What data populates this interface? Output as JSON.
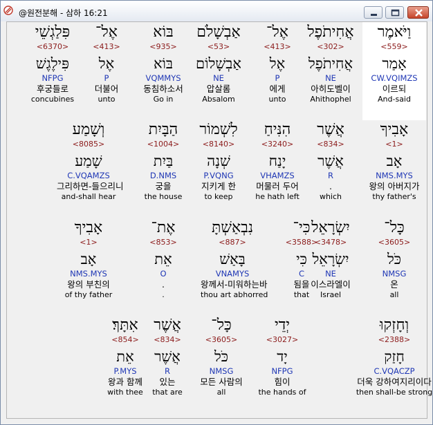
{
  "window": {
    "title": "@원전분해 - 삼하 16:21",
    "minimize_icon": "minimize-icon",
    "maximize_icon": "maximize-icon",
    "close_icon": "close-icon"
  },
  "colors": {
    "strong": "#8b1a1a",
    "morph": "#1f37b5",
    "highlight": "#ffffff",
    "background": "#f0f0f0"
  },
  "rows": [
    [
      {
        "heb": "וַיֹּאמֶר",
        "strong": "<559>",
        "lemma": "אָמַר",
        "morph": "CW.VQIMZS",
        "kor": "이르되",
        "eng": "And-said"
      },
      {
        "heb": "אֲחִיתֹפֶל",
        "strong": "<302>",
        "lemma": "אֲחִיתֹפֶל",
        "morph": "NE",
        "kor": "아히도벨이",
        "eng": "Ahithophel"
      },
      {
        "heb": "אֶל־",
        "strong": "<413>",
        "lemma": "אֶל",
        "morph": "P",
        "kor": "에게",
        "eng": "unto"
      },
      {
        "heb": "אַבְשָׁלֹם",
        "strong": "<53>",
        "lemma": "אַבְשָׁלוֹם",
        "morph": "NE",
        "kor": "압살롬",
        "eng": "Absalom"
      },
      {
        "heb": "בּוֹא",
        "strong": "<935>",
        "lemma": "בּוֹא",
        "morph": "VQMMYS",
        "kor": "동침하소서",
        "eng": "Go in"
      },
      {
        "heb": "אֶל־",
        "strong": "<413>",
        "lemma": "אֶל",
        "morph": "P",
        "kor": "더불어",
        "eng": "unto"
      },
      {
        "heb": "פִּלַגְשֵׁי",
        "strong": "<6370>",
        "lemma": "פִּילֶגֶשׁ",
        "morph": "NFPG",
        "kor": "후궁들로",
        "eng": "concubines"
      }
    ],
    [
      {
        "heb": "אָבִיךָ",
        "strong": "<1>",
        "lemma": "אָב",
        "morph": "NMS.MYS",
        "kor": "왕의 아버지가",
        "eng": "thy father's"
      },
      {
        "heb": "אֲשֶׁר",
        "strong": "<834>",
        "lemma": "אֲשֶׁר",
        "morph": "R",
        "kor": ".",
        "eng": "which"
      },
      {
        "heb": "הִנִּיחַ",
        "strong": "<3240>",
        "lemma": "יָנַח",
        "morph": "VHAMZS",
        "kor": "머물러 두어",
        "eng": "he hath left"
      },
      {
        "heb": "לִשְׁמוֹר",
        "strong": "<8140>",
        "lemma": "שְׁנָה",
        "morph": "P.VQNG",
        "kor": "지키게 한",
        "eng": "to keep"
      },
      {
        "heb": "הַבָּיִת",
        "strong": "<1004>",
        "lemma": "בַּיִת",
        "morph": "D.NMS",
        "kor": "궁을",
        "eng": "the house"
      },
      {
        "heb": "וְשָׁמַע",
        "strong": "<8085>",
        "lemma": "שָׁמַע",
        "morph": "C.VQAMZS",
        "kor": "그리하면-들으리니",
        "eng": "and-shall hear"
      }
    ],
    [
      {
        "heb": "כָּל־",
        "strong": "<3605>",
        "lemma": "כֹּל",
        "morph": "NMSG",
        "kor": "온",
        "eng": "all"
      },
      {
        "heb": "יִשְׂרָאֵל",
        "strong": "<3478>",
        "lemma": "יִשְׂרָאֵל",
        "morph": "NE",
        "kor": "이스라엘이",
        "eng": "Israel"
      },
      {
        "heb": "כִּי־",
        "strong": "<3588>",
        "lemma": "כִּי",
        "morph": "C",
        "kor": "됨을",
        "eng": "that"
      },
      {
        "heb": "נִבְאַשְׁתָּ",
        "strong": "<887>",
        "lemma": "בָּאַשׁ",
        "morph": "VNAMYS",
        "kor": "왕께서-미워하는바",
        "eng": "thou art abhorred"
      },
      {
        "heb": "אֶת־",
        "strong": "<853>",
        "lemma": "אֵת",
        "morph": "O",
        "kor": ".",
        "eng": "."
      },
      {
        "heb": "אָבִיךָ",
        "strong": "<1>",
        "lemma": "אָב",
        "morph": "NMS.MYS",
        "kor": "왕의 부친의",
        "eng": "of thy father"
      }
    ],
    [
      {
        "heb": "וְחָזְקוּ",
        "strong": "<2388>",
        "lemma": "חָזַק",
        "morph": "C.VQACZP",
        "kor": "더욱 강하여지리이다",
        "eng": "then shall-be strong"
      },
      {
        "heb": "יְדֵי",
        "strong": "<3027>",
        "lemma": "יָד",
        "morph": "NFPG",
        "kor": "힘이",
        "eng": "the hands of"
      },
      {
        "heb": "כָּל־",
        "strong": "<3605>",
        "lemma": "כֹּל",
        "morph": "NMSG",
        "kor": "모든 사람의",
        "eng": "all"
      },
      {
        "heb": "אֲשֶׁר",
        "strong": "<834>",
        "lemma": "אֲשֶׁר",
        "morph": "R",
        "kor": "있는",
        "eng": "that are"
      },
      {
        "heb": "אִתָּךְ׃",
        "strong": "<854>",
        "lemma": "אֵת",
        "morph": "P.MYS",
        "kor": "왕과 함께",
        "eng": "with thee"
      }
    ]
  ]
}
